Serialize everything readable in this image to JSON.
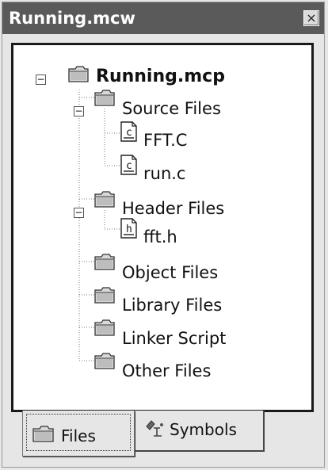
{
  "window": {
    "title": "Running.mcw",
    "close_glyph": "×"
  },
  "tree": {
    "project": "Running.mcp",
    "project_expander": "−",
    "folders": [
      {
        "label": "Source Files",
        "expander": "−",
        "children": [
          "FFT.C",
          "run.c"
        ],
        "file_icon_letter": "c"
      },
      {
        "label": "Header Files",
        "expander": "−",
        "children": [
          "fft.h"
        ],
        "file_icon_letter": "h"
      },
      {
        "label": "Object Files"
      },
      {
        "label": "Library Files"
      },
      {
        "label": "Linker Script"
      },
      {
        "label": "Other Files"
      }
    ]
  },
  "tabs": {
    "files_label": "Files",
    "symbols_label": "Symbols"
  },
  "icons": {
    "folder": "folder-icon",
    "file": "document-icon",
    "symbols": "symbols-icon"
  }
}
